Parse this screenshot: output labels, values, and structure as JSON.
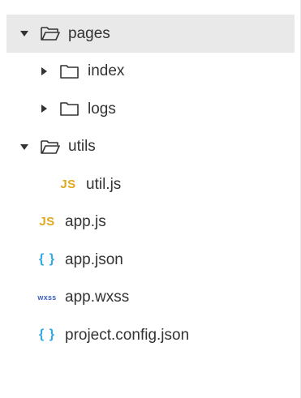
{
  "tree": {
    "pages": {
      "label": "pages",
      "expanded": true,
      "children": {
        "index": {
          "label": "index",
          "expanded": false
        },
        "logs": {
          "label": "logs",
          "expanded": false
        }
      }
    },
    "utils": {
      "label": "utils",
      "expanded": true,
      "children": {
        "util_js": {
          "label": "util.js",
          "badge": "JS"
        }
      }
    },
    "files": {
      "app_js": {
        "label": "app.js",
        "badge": "JS"
      },
      "app_json": {
        "label": "app.json",
        "badge": "{ }"
      },
      "app_wxss": {
        "label": "app.wxss",
        "badge": "wxss"
      },
      "project_config": {
        "label": "project.config.json",
        "badge": "{ }"
      }
    }
  },
  "colors": {
    "js": "#e0a81c",
    "json": "#2ea8e6",
    "wxss": "#3b5fc0",
    "selected_bg": "#e9e9e9",
    "text": "#333333"
  },
  "icons": {
    "expanded": "caret-down-icon",
    "collapsed": "caret-right-icon",
    "folder_open": "folder-open-icon",
    "folder_closed": "folder-icon"
  }
}
